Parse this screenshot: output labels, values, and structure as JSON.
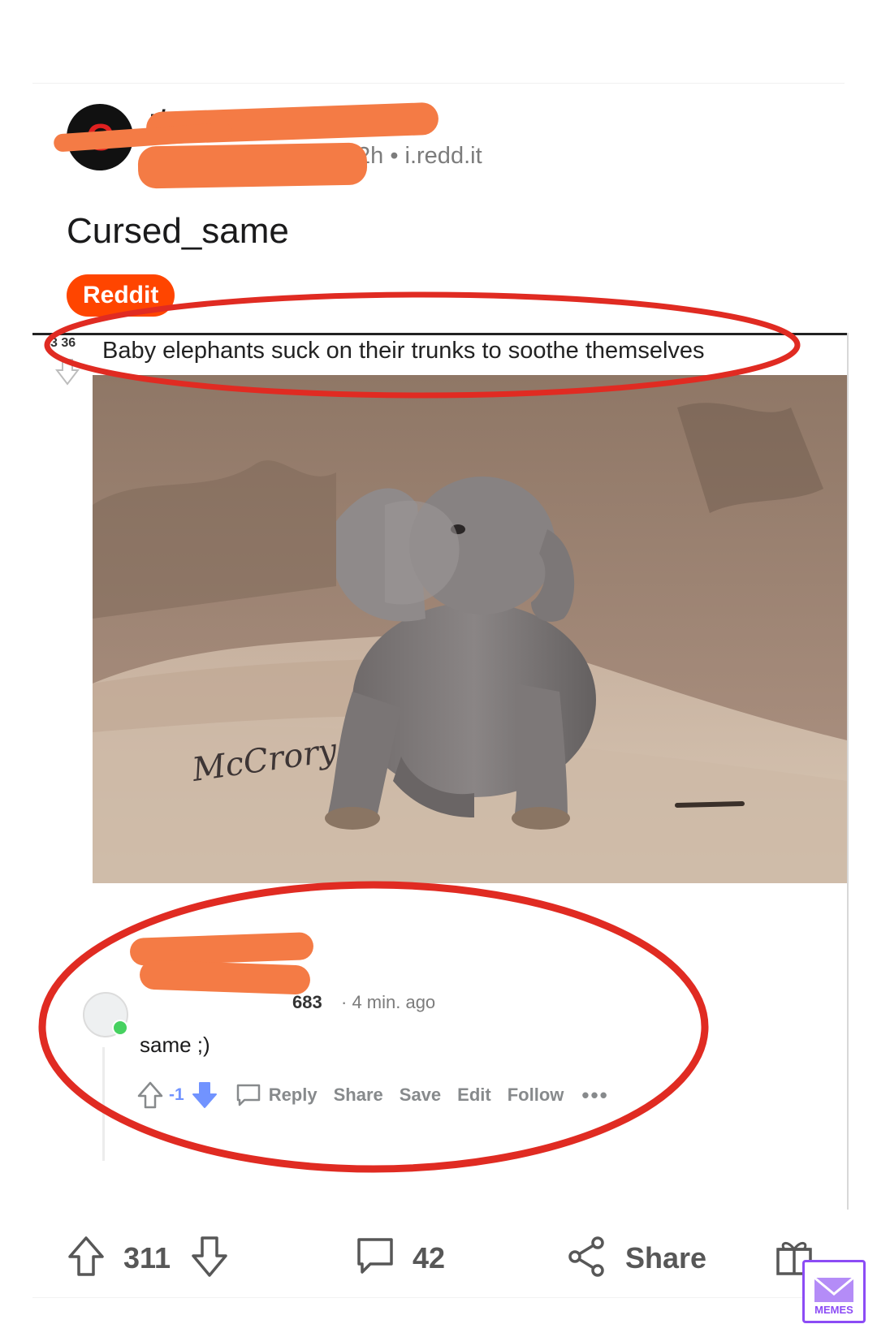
{
  "post": {
    "subreddit_prefix": "r/",
    "meta": "2h • i.redd.it",
    "title": "Cursed_same",
    "flair": "Reddit"
  },
  "screenshot": {
    "score": "3 36",
    "title": "Baby elephants suck on their trunks to soothe themselves",
    "watermark": "McCrory",
    "comment": {
      "user_tail": "683",
      "time": "· 4 min. ago",
      "body": "same ;)",
      "vote_count": "-1",
      "actions": [
        "Reply",
        "Share",
        "Save",
        "Edit",
        "Follow"
      ],
      "more": "•••"
    }
  },
  "bar": {
    "upvotes": "311",
    "comments": "42",
    "share": "Share"
  },
  "badge": {
    "text": "MEMES"
  },
  "colors": {
    "flair": "#ff4500",
    "annotation": "#e02b22",
    "redaction": "#f47b45",
    "downvote_active": "#7193ff"
  }
}
